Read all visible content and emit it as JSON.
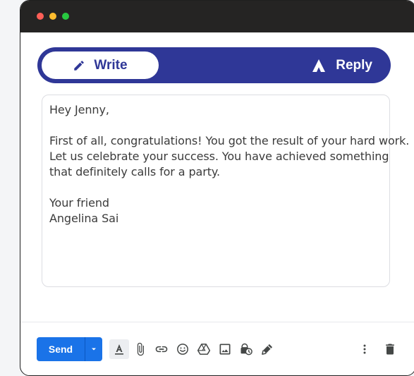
{
  "composer": {
    "tabs": [
      {
        "label": "Write",
        "icon": "pencil-icon",
        "selected": true
      },
      {
        "label": "Reply",
        "icon": "reply-brand-icon",
        "selected": false
      }
    ],
    "body_lines": [
      "Hey Jenny,",
      "",
      "First of all, congratulations! You got the result of your hard work.",
      "Let us celebrate your success. You have achieved something",
      "that definitely calls for a party.",
      "",
      "Your friend",
      "Angelina Sai"
    ]
  },
  "footer": {
    "send_label": "Send",
    "tools": [
      "text-format-icon",
      "attach-icon",
      "link-icon",
      "emoji-icon",
      "drive-icon",
      "image-icon",
      "confidential-lock-icon",
      "signature-pen-icon"
    ],
    "right_tools": [
      "more-options-icon",
      "trash-icon"
    ]
  },
  "colors": {
    "accent": "#2f3797",
    "send": "#1a73e8",
    "titlebar": "#252423"
  }
}
